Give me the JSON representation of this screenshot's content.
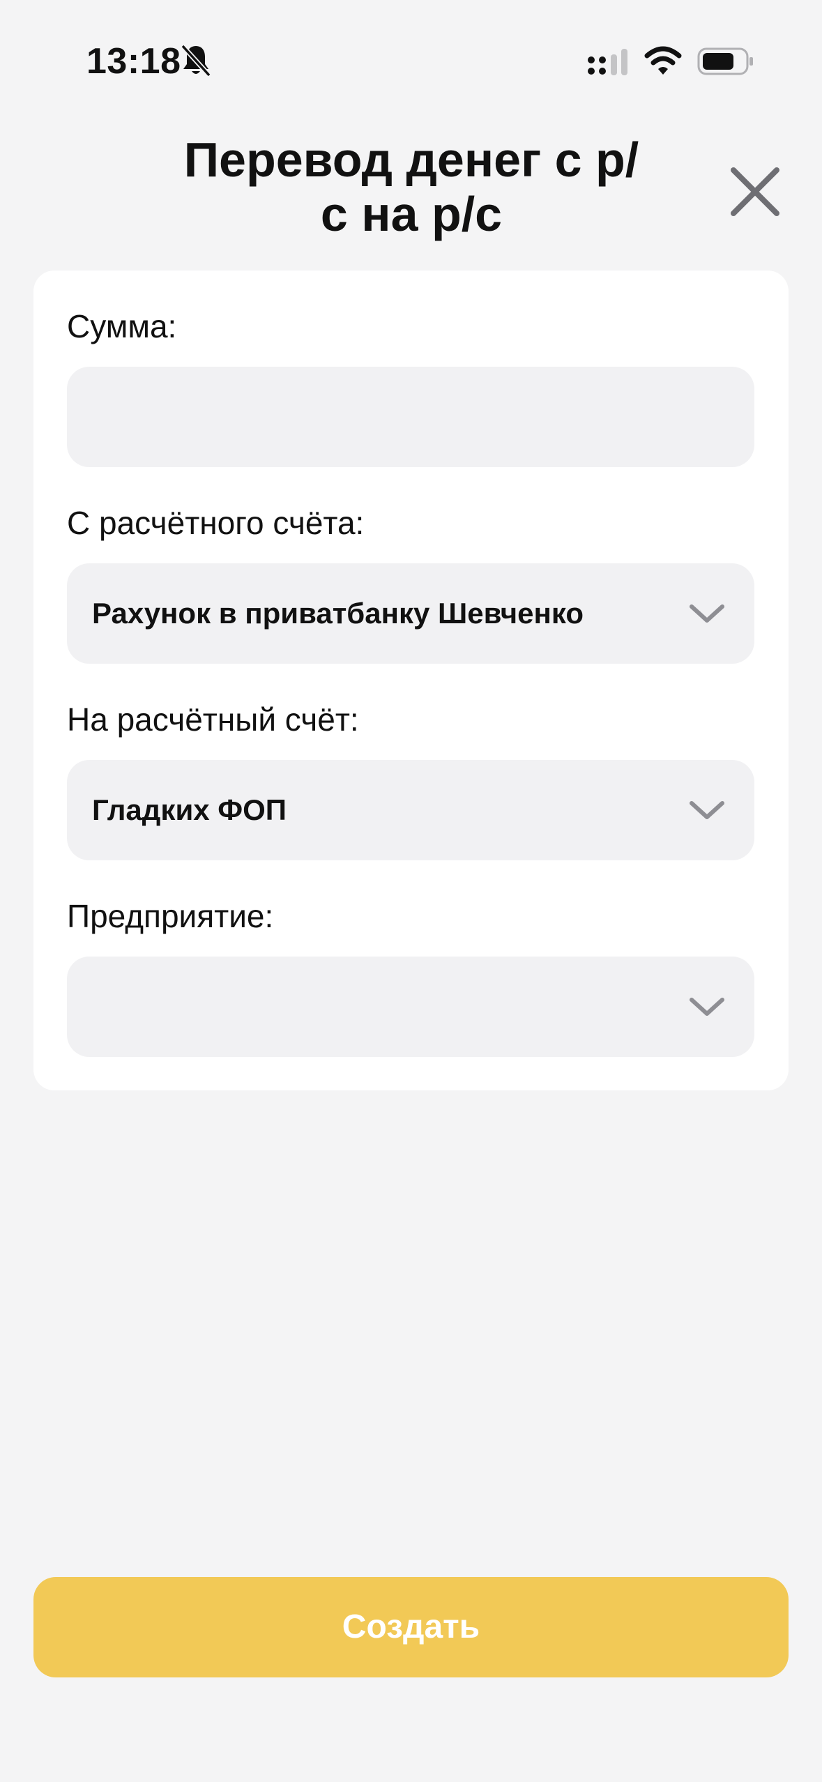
{
  "status_bar": {
    "time": "13:18",
    "icons": [
      "bell-slash-icon",
      "signal-icon",
      "wifi-icon",
      "battery-icon"
    ]
  },
  "header": {
    "title_line1": "Перевод денег с р/",
    "title_line2": "с на р/с",
    "close_icon": "close-icon"
  },
  "form": {
    "amount": {
      "label": "Сумма:",
      "value": ""
    },
    "from_account": {
      "label": "С расчётного счёта:",
      "value": "Рахунок в приватбанку Шевченко"
    },
    "to_account": {
      "label": "На расчётный счёт:",
      "value": "Гладких ФОП"
    },
    "enterprise": {
      "label": "Предприятие:",
      "value": ""
    }
  },
  "actions": {
    "create_label": "Создать"
  },
  "colors": {
    "background": "#f4f4f5",
    "card": "#ffffff",
    "field": "#f1f1f3",
    "accent": "#f2c956",
    "chevron": "#8e8e93"
  }
}
